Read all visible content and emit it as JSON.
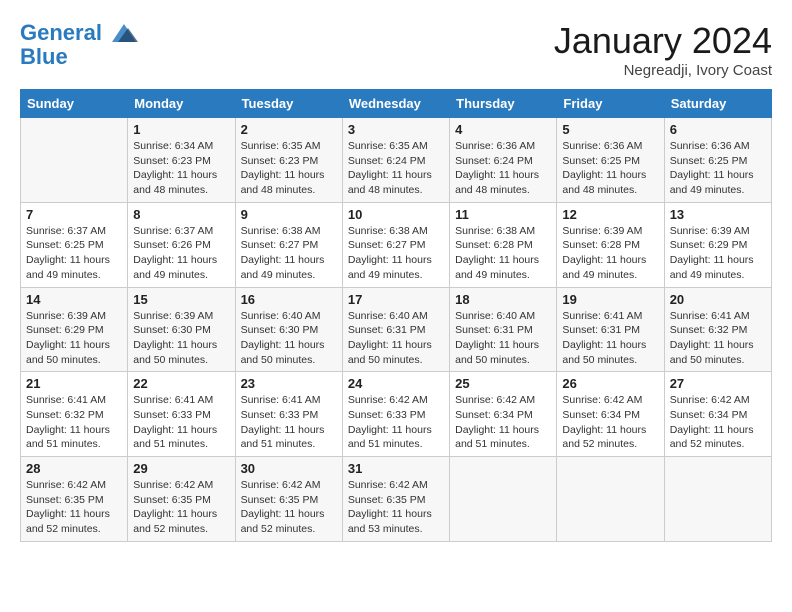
{
  "header": {
    "logo_line1": "General",
    "logo_line2": "Blue",
    "month": "January 2024",
    "location": "Negreadji, Ivory Coast"
  },
  "days_of_week": [
    "Sunday",
    "Monday",
    "Tuesday",
    "Wednesday",
    "Thursday",
    "Friday",
    "Saturday"
  ],
  "weeks": [
    [
      {
        "day": "",
        "content": ""
      },
      {
        "day": "1",
        "content": "Sunrise: 6:34 AM\nSunset: 6:23 PM\nDaylight: 11 hours and 48 minutes."
      },
      {
        "day": "2",
        "content": "Sunrise: 6:35 AM\nSunset: 6:23 PM\nDaylight: 11 hours and 48 minutes."
      },
      {
        "day": "3",
        "content": "Sunrise: 6:35 AM\nSunset: 6:24 PM\nDaylight: 11 hours and 48 minutes."
      },
      {
        "day": "4",
        "content": "Sunrise: 6:36 AM\nSunset: 6:24 PM\nDaylight: 11 hours and 48 minutes."
      },
      {
        "day": "5",
        "content": "Sunrise: 6:36 AM\nSunset: 6:25 PM\nDaylight: 11 hours and 48 minutes."
      },
      {
        "day": "6",
        "content": "Sunrise: 6:36 AM\nSunset: 6:25 PM\nDaylight: 11 hours and 49 minutes."
      }
    ],
    [
      {
        "day": "7",
        "content": "Sunrise: 6:37 AM\nSunset: 6:25 PM\nDaylight: 11 hours and 49 minutes."
      },
      {
        "day": "8",
        "content": "Sunrise: 6:37 AM\nSunset: 6:26 PM\nDaylight: 11 hours and 49 minutes."
      },
      {
        "day": "9",
        "content": "Sunrise: 6:38 AM\nSunset: 6:27 PM\nDaylight: 11 hours and 49 minutes."
      },
      {
        "day": "10",
        "content": "Sunrise: 6:38 AM\nSunset: 6:27 PM\nDaylight: 11 hours and 49 minutes."
      },
      {
        "day": "11",
        "content": "Sunrise: 6:38 AM\nSunset: 6:28 PM\nDaylight: 11 hours and 49 minutes."
      },
      {
        "day": "12",
        "content": "Sunrise: 6:39 AM\nSunset: 6:28 PM\nDaylight: 11 hours and 49 minutes."
      },
      {
        "day": "13",
        "content": "Sunrise: 6:39 AM\nSunset: 6:29 PM\nDaylight: 11 hours and 49 minutes."
      }
    ],
    [
      {
        "day": "14",
        "content": "Sunrise: 6:39 AM\nSunset: 6:29 PM\nDaylight: 11 hours and 50 minutes."
      },
      {
        "day": "15",
        "content": "Sunrise: 6:39 AM\nSunset: 6:30 PM\nDaylight: 11 hours and 50 minutes."
      },
      {
        "day": "16",
        "content": "Sunrise: 6:40 AM\nSunset: 6:30 PM\nDaylight: 11 hours and 50 minutes."
      },
      {
        "day": "17",
        "content": "Sunrise: 6:40 AM\nSunset: 6:31 PM\nDaylight: 11 hours and 50 minutes."
      },
      {
        "day": "18",
        "content": "Sunrise: 6:40 AM\nSunset: 6:31 PM\nDaylight: 11 hours and 50 minutes."
      },
      {
        "day": "19",
        "content": "Sunrise: 6:41 AM\nSunset: 6:31 PM\nDaylight: 11 hours and 50 minutes."
      },
      {
        "day": "20",
        "content": "Sunrise: 6:41 AM\nSunset: 6:32 PM\nDaylight: 11 hours and 50 minutes."
      }
    ],
    [
      {
        "day": "21",
        "content": "Sunrise: 6:41 AM\nSunset: 6:32 PM\nDaylight: 11 hours and 51 minutes."
      },
      {
        "day": "22",
        "content": "Sunrise: 6:41 AM\nSunset: 6:33 PM\nDaylight: 11 hours and 51 minutes."
      },
      {
        "day": "23",
        "content": "Sunrise: 6:41 AM\nSunset: 6:33 PM\nDaylight: 11 hours and 51 minutes."
      },
      {
        "day": "24",
        "content": "Sunrise: 6:42 AM\nSunset: 6:33 PM\nDaylight: 11 hours and 51 minutes."
      },
      {
        "day": "25",
        "content": "Sunrise: 6:42 AM\nSunset: 6:34 PM\nDaylight: 11 hours and 51 minutes."
      },
      {
        "day": "26",
        "content": "Sunrise: 6:42 AM\nSunset: 6:34 PM\nDaylight: 11 hours and 52 minutes."
      },
      {
        "day": "27",
        "content": "Sunrise: 6:42 AM\nSunset: 6:34 PM\nDaylight: 11 hours and 52 minutes."
      }
    ],
    [
      {
        "day": "28",
        "content": "Sunrise: 6:42 AM\nSunset: 6:35 PM\nDaylight: 11 hours and 52 minutes."
      },
      {
        "day": "29",
        "content": "Sunrise: 6:42 AM\nSunset: 6:35 PM\nDaylight: 11 hours and 52 minutes."
      },
      {
        "day": "30",
        "content": "Sunrise: 6:42 AM\nSunset: 6:35 PM\nDaylight: 11 hours and 52 minutes."
      },
      {
        "day": "31",
        "content": "Sunrise: 6:42 AM\nSunset: 6:35 PM\nDaylight: 11 hours and 53 minutes."
      },
      {
        "day": "",
        "content": ""
      },
      {
        "day": "",
        "content": ""
      },
      {
        "day": "",
        "content": ""
      }
    ]
  ]
}
